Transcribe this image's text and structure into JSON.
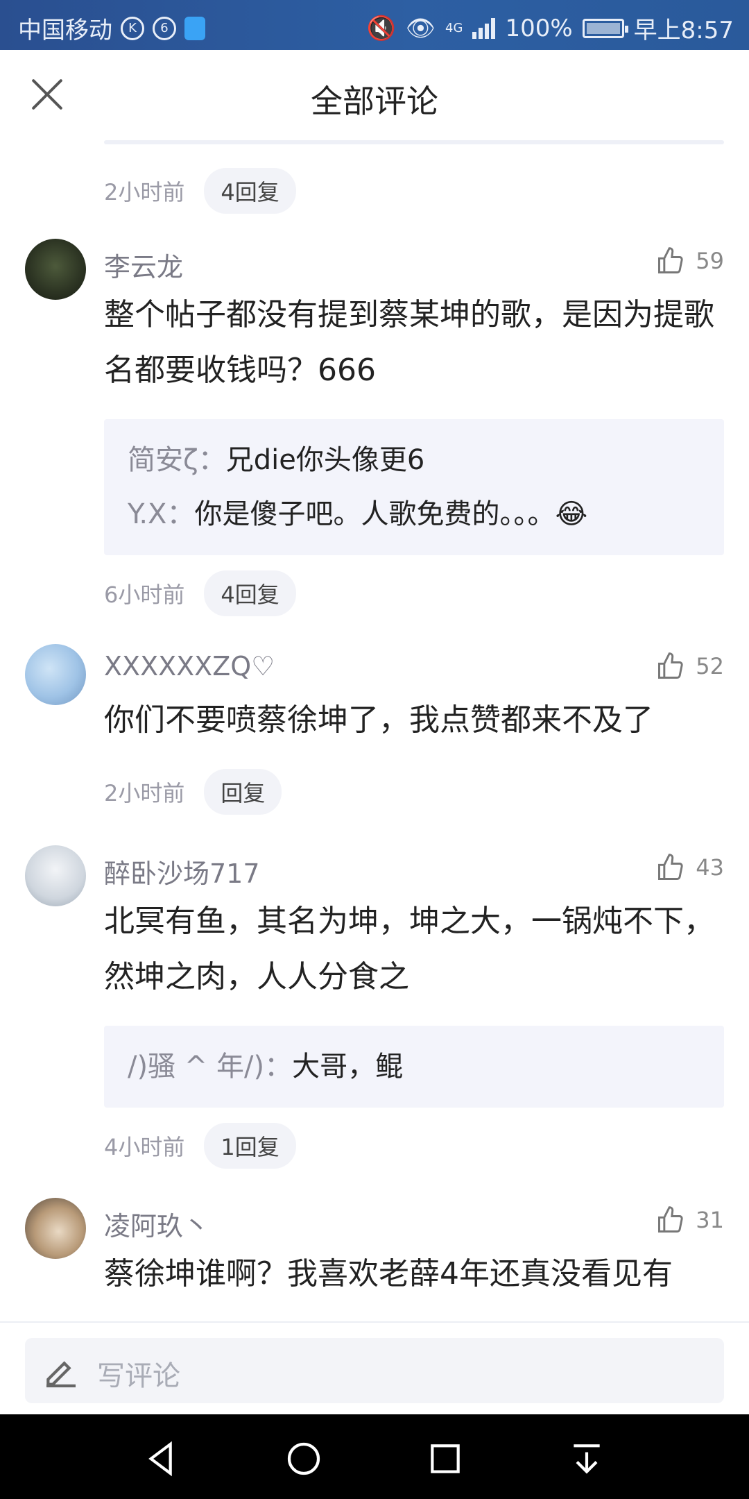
{
  "status_bar": {
    "carrier": "中国移动",
    "network": "4G",
    "battery": "100%",
    "time": "早上8:57"
  },
  "header": {
    "title": "全部评论"
  },
  "top_meta": {
    "time": "2小时前",
    "reply_count": "4回复"
  },
  "comments": [
    {
      "user": "李云龙",
      "likes": "59",
      "text": "整个帖子都没有提到蔡某坤的歌，是因为提歌名都要收钱吗？666",
      "replies": [
        {
          "name": "简安ζ：",
          "text": "兄die你头像更6"
        },
        {
          "name": "Y.X：",
          "text": "你是傻子吧。人歌免费的。。。😂"
        }
      ],
      "time": "6小时前",
      "reply_label": "4回复"
    },
    {
      "user": "XXXXXXZQ♡",
      "likes": "52",
      "text": "你们不要喷蔡徐坤了，我点赞都来不及了",
      "replies": [],
      "time": "2小时前",
      "reply_label": "回复"
    },
    {
      "user": "醉卧沙场717",
      "likes": "43",
      "text": "北冥有鱼，其名为坤，坤之大，一锅炖不下，然坤之肉，人人分食之",
      "replies": [
        {
          "name": "/)骚 ^ 年/)：",
          "text": "大哥，鲲"
        }
      ],
      "time": "4小时前",
      "reply_label": "1回复"
    },
    {
      "user": "凌阿玖丶",
      "likes": "31",
      "text": "蔡徐坤谁啊？我喜欢老薛4年还真没看见有",
      "replies": [],
      "time": "",
      "reply_label": ""
    }
  ],
  "input": {
    "placeholder": "写评论"
  },
  "colors": {
    "status_bar": "#2d5fa3",
    "reply_bg": "#f3f4fb",
    "muted_text": "#9a9aa6"
  },
  "icons": [
    "close-icon",
    "thumbs-up-icon",
    "pencil-icon",
    "back-icon",
    "home-icon",
    "recents-icon",
    "notification-icon"
  ]
}
